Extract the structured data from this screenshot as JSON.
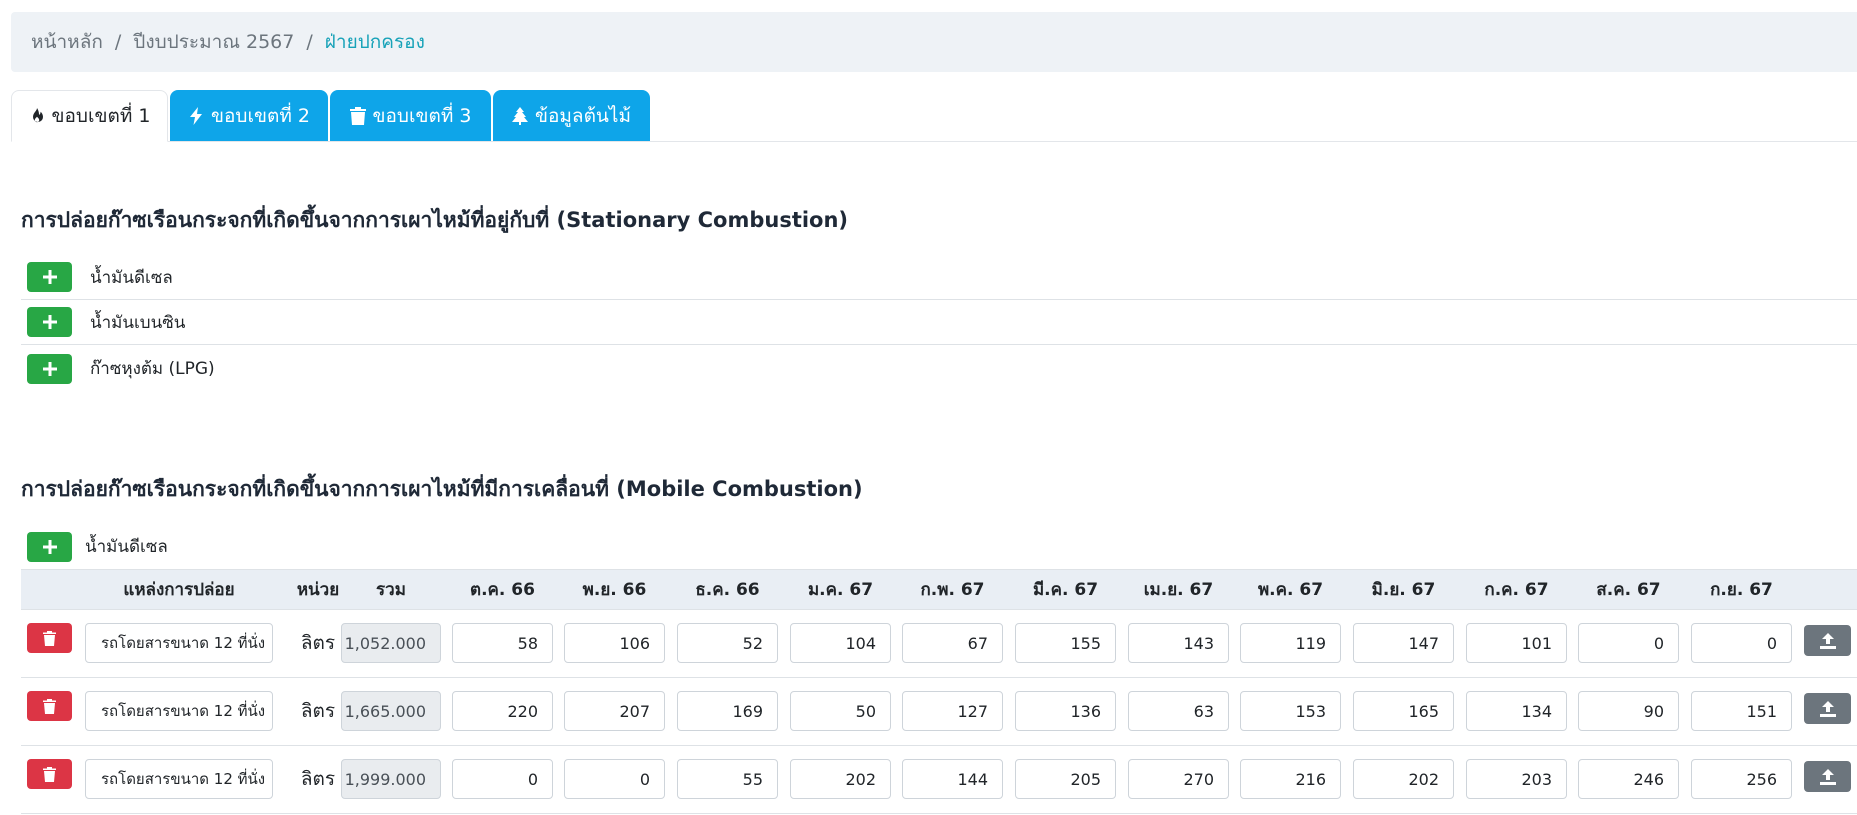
{
  "breadcrumb": {
    "home": "หน้าหลัก",
    "budget_year": "ปีงบประมาณ 2567",
    "current": "ฝ่ายปกครอง",
    "separator": "/"
  },
  "tabs": [
    {
      "label": "ขอบเขตที่ 1",
      "icon": "fire-icon",
      "active": true
    },
    {
      "label": "ขอบเขตที่ 2",
      "icon": "bolt-icon",
      "active": false
    },
    {
      "label": "ขอบเขตที่ 3",
      "icon": "trash-icon",
      "active": false
    },
    {
      "label": "ข้อมูลต้นไม้",
      "icon": "tree-icon",
      "active": false
    }
  ],
  "stationary": {
    "title": "การปล่อยก๊าซเรือนกระจกที่เกิดขึ้นจากการเผาไหม้ที่อยู่กับที่ (Stationary Combustion)",
    "items": [
      "น้ำมันดีเซล",
      "น้ำมันเบนซิน",
      "ก๊าซหุงต้ม (LPG)"
    ]
  },
  "mobile": {
    "title": "การปล่อยก๊าซเรือนกระจกที่เกิดขึ้นจากการเผาไหม้ที่มีการเคลื่อนที่ (Mobile Combustion)",
    "fuel_label": "น้ำมันดีเซล",
    "headers": {
      "source": "แหล่งการปล่อย",
      "unit": "หน่วย",
      "total": "รวม",
      "months": [
        "ต.ค. 66",
        "พ.ย. 66",
        "ธ.ค. 66",
        "ม.ค. 67",
        "ก.พ. 67",
        "มี.ค. 67",
        "เม.ย. 67",
        "พ.ค. 67",
        "มิ.ย. 67",
        "ก.ค. 67",
        "ส.ค. 67",
        "ก.ย. 67"
      ]
    },
    "rows": [
      {
        "source": "รถโดยสารขนาด 12 ที่นั่ง",
        "unit": "ลิตร",
        "total": "1,052.000",
        "months": [
          "58",
          "106",
          "52",
          "104",
          "67",
          "155",
          "143",
          "119",
          "147",
          "101",
          "0",
          "0"
        ]
      },
      {
        "source": "รถโดยสารขนาด 12 ที่นั่ง",
        "unit": "ลิตร",
        "total": "1,665.000",
        "months": [
          "220",
          "207",
          "169",
          "50",
          "127",
          "136",
          "63",
          "153",
          "165",
          "134",
          "90",
          "151"
        ]
      },
      {
        "source": "รถโดยสารขนาด 12 ที่นั่ง",
        "unit": "ลิตร",
        "total": "1,999.000",
        "months": [
          "0",
          "0",
          "55",
          "202",
          "144",
          "205",
          "270",
          "216",
          "202",
          "203",
          "246",
          "256"
        ]
      }
    ]
  },
  "colors": {
    "tab_blue": "#0ea5e9",
    "add_green": "#28a745",
    "delete_red": "#dc3545",
    "upload_gray": "#6c757d",
    "breadcrumb_active": "#17a2b8"
  }
}
